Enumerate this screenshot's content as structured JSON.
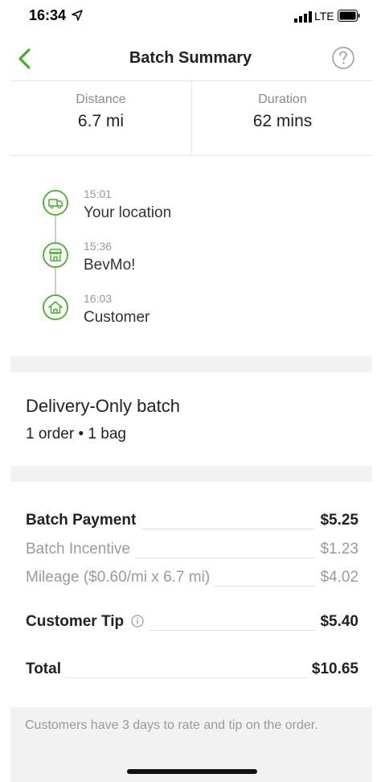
{
  "status_bar": {
    "time": "16:34",
    "network": "LTE"
  },
  "nav": {
    "title": "Batch Summary"
  },
  "stats": {
    "distance_label": "Distance",
    "distance_value": "6.7 mi",
    "duration_label": "Duration",
    "duration_value": "62 mins"
  },
  "timeline": [
    {
      "time": "15:01",
      "label": "Your location",
      "icon": "truck-icon"
    },
    {
      "time": "15:36",
      "label": "BevMo!",
      "icon": "store-icon"
    },
    {
      "time": "16:03",
      "label": "Customer",
      "icon": "home-icon"
    }
  ],
  "batch": {
    "type": "Delivery-Only batch",
    "meta": "1 order • 1 bag"
  },
  "payment": {
    "batch_payment_label": "Batch Payment",
    "batch_payment_value": "$5.25",
    "incentive_label": "Batch Incentive",
    "incentive_value": "$1.23",
    "mileage_label": "Mileage ($0.60/mi x 6.7 mi)",
    "mileage_value": "$4.02",
    "tip_label": "Customer Tip",
    "tip_value": "$5.40",
    "total_label": "Total",
    "total_value": "$10.65"
  },
  "footer": {
    "note": "Customers have 3 days to rate and tip on the order."
  },
  "colors": {
    "accent": "#43b02a",
    "muted": "#9a9a9a",
    "separator": "#f2f2f2"
  }
}
